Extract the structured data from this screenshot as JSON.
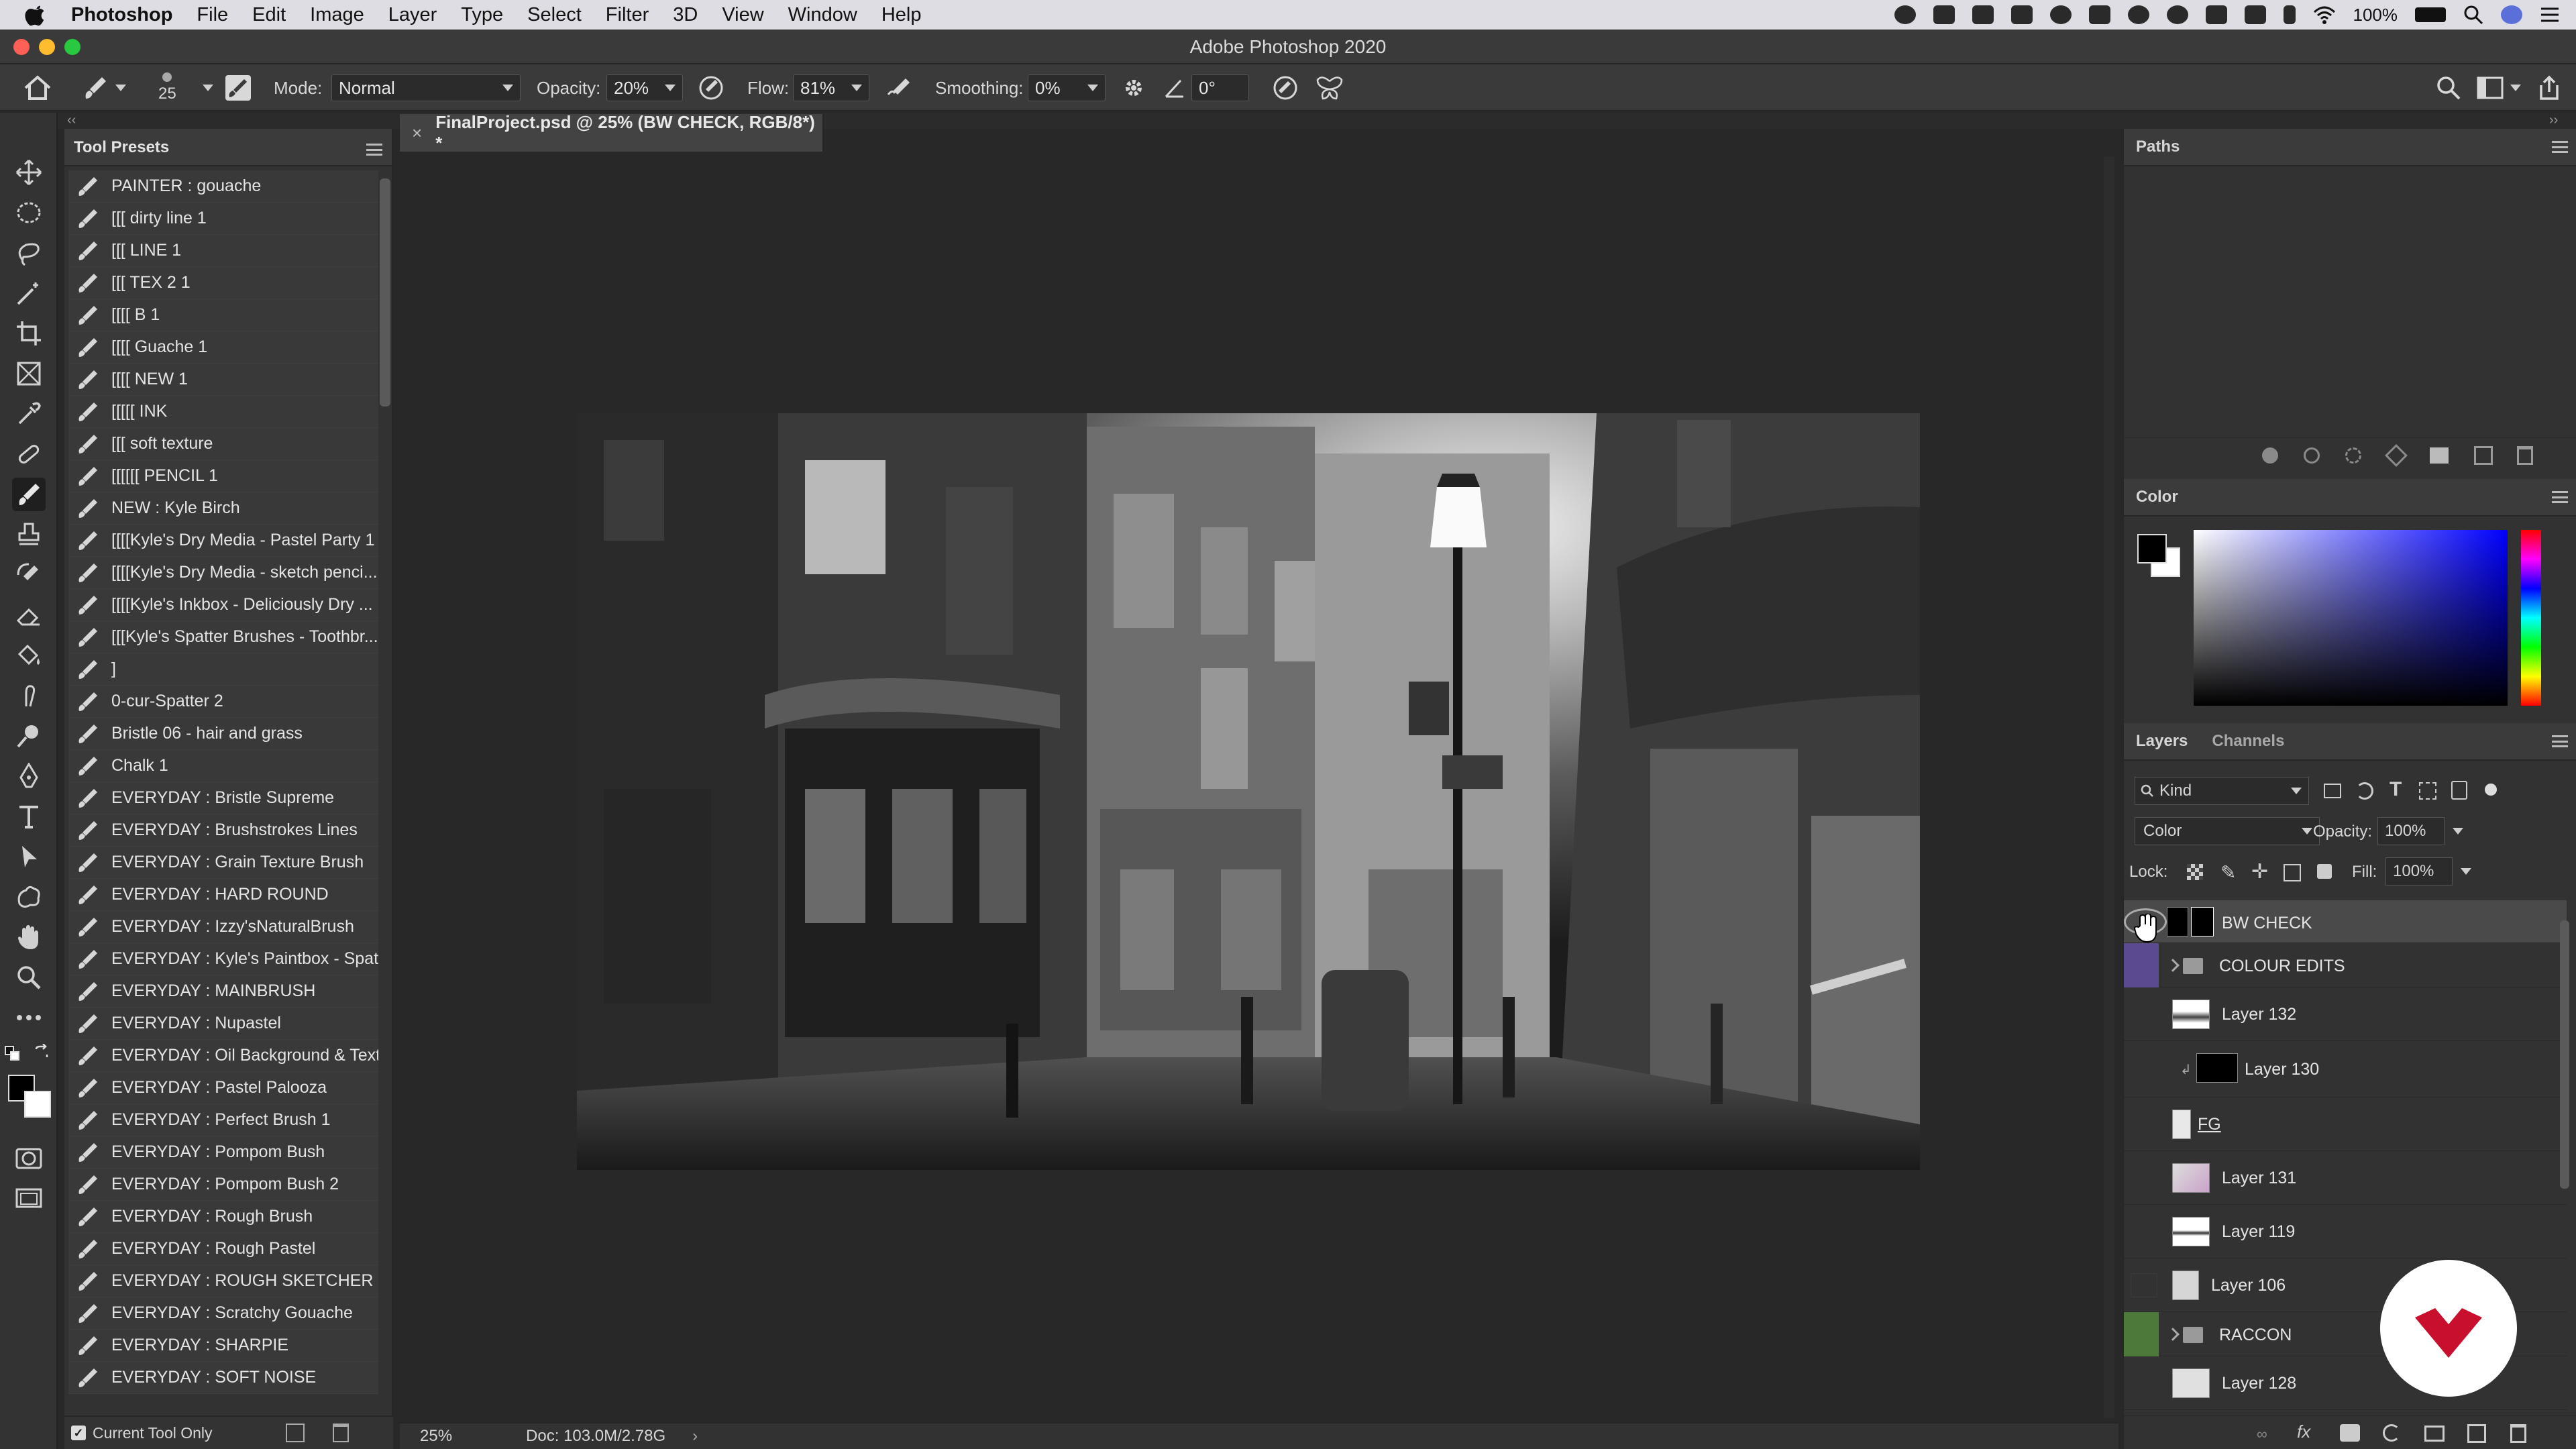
{
  "menubar": {
    "app": "Photoshop",
    "items": [
      "File",
      "Edit",
      "Image",
      "Layer",
      "Type",
      "Select",
      "Filter",
      "3D",
      "View",
      "Window",
      "Help"
    ],
    "battery": "100%"
  },
  "titlebar": {
    "title": "Adobe Photoshop 2020"
  },
  "options": {
    "brush_size": "25",
    "mode_label": "Mode:",
    "mode_value": "Normal",
    "opacity_label": "Opacity:",
    "opacity_value": "20%",
    "flow_label": "Flow:",
    "flow_value": "81%",
    "smoothing_label": "Smoothing:",
    "smoothing_value": "0%",
    "angle_value": "0°"
  },
  "presets": {
    "title": "Tool Presets",
    "items": [
      "PAINTER : gouache",
      "[[[ dirty line 1",
      "[[[ LINE 1",
      "[[[ TEX 2 1",
      "[[[[ B 1",
      "[[[[ Guache 1",
      "[[[[ NEW 1",
      "[[[[[ INK",
      "[[[ soft texture",
      "[[[[[[ PENCIL 1",
      "NEW : Kyle Birch",
      "[[[[Kyle's Dry Media - Pastel Party 1",
      "[[[[Kyle's Dry Media - sketch penci...",
      "[[[[Kyle's Inkbox - Deliciously Dry ...",
      "[[[Kyle's Spatter Brushes - Toothbr...",
      "]",
      "0-cur-Spatter 2",
      "Bristle 06 - hair and grass",
      "Chalk 1",
      "EVERYDAY : Bristle Supreme",
      "EVERYDAY : Brushstrokes Lines",
      "EVERYDAY : Grain Texture Brush",
      "EVERYDAY : HARD ROUND",
      "EVERYDAY : Izzy'sNaturalBrush",
      "EVERYDAY : Kyle's Paintbox - Spat...",
      "EVERYDAY : MAINBRUSH",
      "EVERYDAY : Nupastel",
      "EVERYDAY : Oil Background & Text...",
      "EVERYDAY : Pastel Palooza",
      "EVERYDAY : Perfect Brush 1",
      "EVERYDAY : Pompom Bush",
      "EVERYDAY : Pompom Bush 2",
      "EVERYDAY : Rough Brush",
      "EVERYDAY : Rough Pastel",
      "EVERYDAY : ROUGH SKETCHER",
      "EVERYDAY : Scratchy Gouache",
      "EVERYDAY : SHARPIE",
      "EVERYDAY : SOFT NOISE"
    ],
    "current_tool_only": "Current Tool Only"
  },
  "document": {
    "tab_title": "FinalProject.psd @ 25% (BW CHECK, RGB/8*) *",
    "zoom": "25%",
    "doc_size": "Doc: 103.0M/2.78G"
  },
  "paths": {
    "title": "Paths"
  },
  "color": {
    "title": "Color"
  },
  "layers": {
    "tab_layers": "Layers",
    "tab_channels": "Channels",
    "filter_kind": "Kind",
    "blend_mode": "Color",
    "opacity_label": "Opacity:",
    "opacity_value": "100%",
    "lock_label": "Lock:",
    "fill_label": "Fill:",
    "fill_value": "100%",
    "rows": [
      {
        "name": "BW CHECK"
      },
      {
        "name": "COLOUR EDITS"
      },
      {
        "name": "Layer 132"
      },
      {
        "name": "Layer 130"
      },
      {
        "name": "FG"
      },
      {
        "name": "Layer 131"
      },
      {
        "name": "Layer 119"
      },
      {
        "name": "Layer 106"
      },
      {
        "name": "RACCON"
      },
      {
        "name": "Layer 128"
      }
    ]
  },
  "colors": {
    "accent_purple": "#5b4a8e",
    "accent_green": "#4d7a3a",
    "logo_red": "#c8102e"
  }
}
